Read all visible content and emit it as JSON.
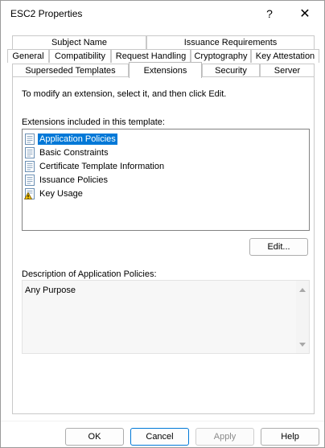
{
  "window": {
    "title": "ESC2 Properties",
    "help_glyph": "?",
    "close_glyph": "✕"
  },
  "tabs": {
    "row1": [
      "Subject Name",
      "Issuance Requirements"
    ],
    "row2": [
      "General",
      "Compatibility",
      "Request Handling",
      "Cryptography",
      "Key Attestation"
    ],
    "row3": [
      "Superseded Templates",
      "Extensions",
      "Security",
      "Server"
    ],
    "active": "Extensions"
  },
  "panel": {
    "instruction": "To modify an extension, select it, and then click Edit.",
    "list_label": "Extensions included in this template:",
    "extensions": [
      {
        "label": "Application Policies",
        "icon": "certificate-extension-icon",
        "selected": true
      },
      {
        "label": "Basic Constraints",
        "icon": "certificate-extension-icon",
        "selected": false
      },
      {
        "label": "Certificate Template Information",
        "icon": "certificate-extension-icon",
        "selected": false
      },
      {
        "label": "Issuance Policies",
        "icon": "certificate-extension-icon",
        "selected": false
      },
      {
        "label": "Key Usage",
        "icon": "critical-extension-warning-icon",
        "selected": false
      }
    ],
    "edit_label": "Edit...",
    "description_label": "Description of Application Policies:",
    "description_text": "Any Purpose"
  },
  "buttons": {
    "ok": "OK",
    "cancel": "Cancel",
    "apply": "Apply",
    "help": "Help"
  },
  "colors": {
    "selection": "#0078d7",
    "border": "#c9c9c9"
  }
}
